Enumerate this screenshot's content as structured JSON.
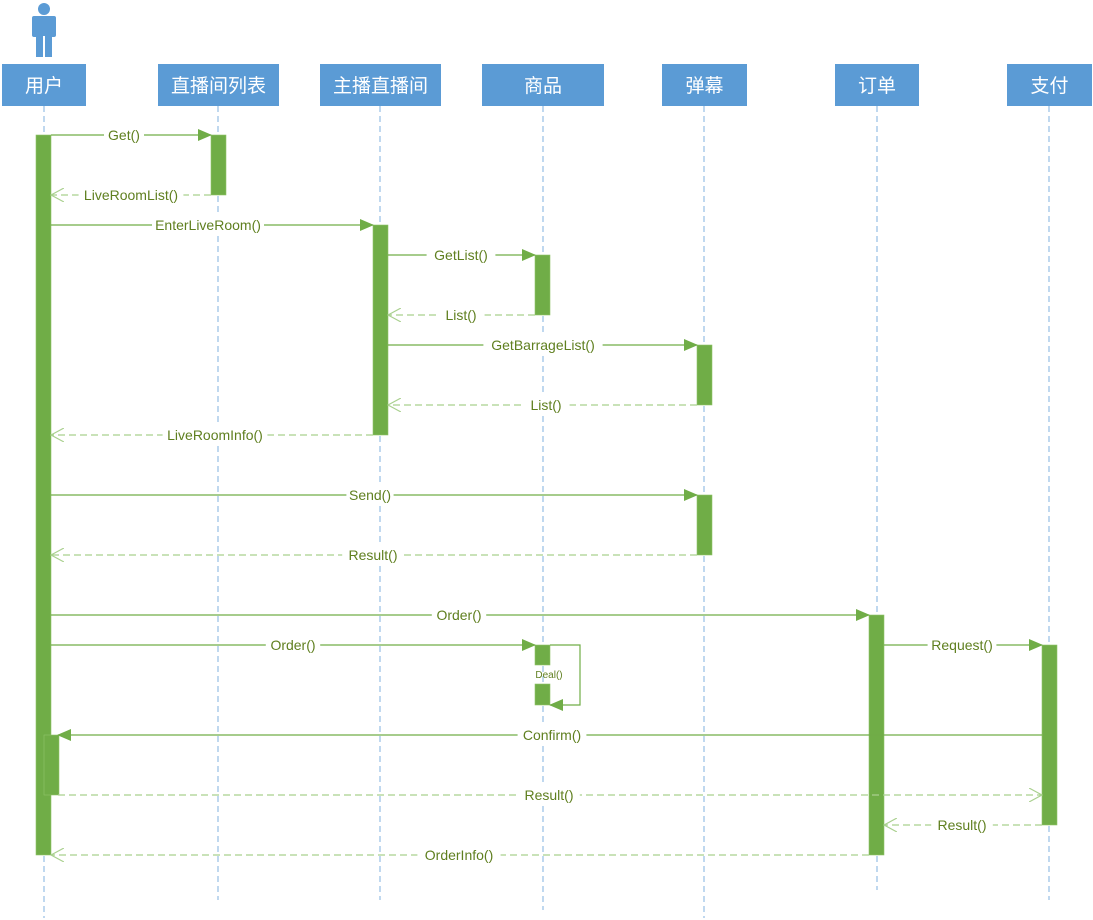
{
  "diagram": {
    "type": "sequence",
    "colors": {
      "header_fill": "#5b9bd5",
      "header_text": "#ffffff",
      "lifeline": "#9dc3e6",
      "activation": "#70ad47",
      "message": "#70ad47",
      "return_message": "#a9d08e",
      "message_text": "#5f7f1f",
      "actor_icon": "#5b9bd5"
    },
    "actor_icon": "person-icon",
    "participants": [
      {
        "id": "user",
        "label": "用户"
      },
      {
        "id": "roomlist",
        "label": "直播间列表"
      },
      {
        "id": "room",
        "label": "主播直播间"
      },
      {
        "id": "goods",
        "label": "商品"
      },
      {
        "id": "barrage",
        "label": "弹幕"
      },
      {
        "id": "order",
        "label": "订单"
      },
      {
        "id": "pay",
        "label": "支付"
      }
    ],
    "messages": [
      {
        "from": "user",
        "to": "roomlist",
        "label": "Get()",
        "kind": "call"
      },
      {
        "from": "roomlist",
        "to": "user",
        "label": "LiveRoomList()",
        "kind": "return"
      },
      {
        "from": "user",
        "to": "room",
        "label": "EnterLiveRoom()",
        "kind": "call"
      },
      {
        "from": "room",
        "to": "goods",
        "label": "GetList()",
        "kind": "call"
      },
      {
        "from": "goods",
        "to": "room",
        "label": "List()",
        "kind": "return"
      },
      {
        "from": "room",
        "to": "barrage",
        "label": "GetBarrageList()",
        "kind": "call"
      },
      {
        "from": "barrage",
        "to": "room",
        "label": "List()",
        "kind": "return"
      },
      {
        "from": "room",
        "to": "user",
        "label": "LiveRoomInfo()",
        "kind": "return"
      },
      {
        "from": "user",
        "to": "barrage",
        "label": "Send()",
        "kind": "call"
      },
      {
        "from": "barrage",
        "to": "user",
        "label": "Result()",
        "kind": "return"
      },
      {
        "from": "user",
        "to": "order",
        "label": "Order()",
        "kind": "call"
      },
      {
        "from": "user",
        "to": "goods",
        "label": "Order()",
        "kind": "call"
      },
      {
        "from": "goods",
        "to": "goods",
        "label": "Deal()",
        "kind": "self"
      },
      {
        "from": "order",
        "to": "pay",
        "label": "Request()",
        "kind": "call"
      },
      {
        "from": "pay",
        "to": "user",
        "label": "Confirm()",
        "kind": "call"
      },
      {
        "from": "user",
        "to": "pay",
        "label": "Result()",
        "kind": "return"
      },
      {
        "from": "pay",
        "to": "order",
        "label": "Result()",
        "kind": "return"
      },
      {
        "from": "order",
        "to": "user",
        "label": "OrderInfo()",
        "kind": "return"
      }
    ]
  }
}
